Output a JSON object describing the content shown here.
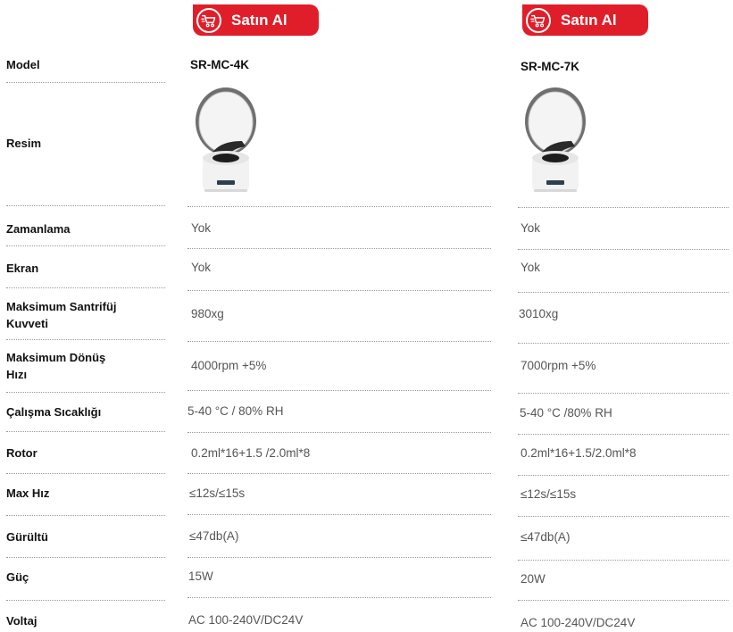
{
  "buttons": {
    "buy_label": "Satın Al"
  },
  "colors": {
    "accent": "#e01e2a",
    "label_text": "#111111",
    "value_text": "#555555",
    "divider": "#999999"
  },
  "icons": {
    "buy": "shopping-cart-icon",
    "product": "mini-centrifuge-image"
  },
  "products": [
    {
      "model": "SR-MC-4K"
    },
    {
      "model": "SR-MC-7K"
    }
  ],
  "rows": [
    {
      "label": "Model"
    },
    {
      "label": "Resim"
    },
    {
      "label": "Zamanlama",
      "values": [
        "Yok",
        "Yok"
      ]
    },
    {
      "label": "Ekran",
      "values": [
        "Yok",
        "Yok"
      ]
    },
    {
      "label_lines": [
        "Maksimum Santrifüj",
        "Kuvveti"
      ],
      "values": [
        "980xg",
        "3010xg"
      ]
    },
    {
      "label_lines": [
        "Maksimum Dönüş",
        "Hızı"
      ],
      "values": [
        "4000rpm +5%",
        "7000rpm +5%"
      ]
    },
    {
      "label": "Çalışma Sıcaklığı",
      "values": [
        "5-40 °C / 80% RH",
        "5-40 °C /80% RH"
      ]
    },
    {
      "label": "Rotor",
      "values": [
        "0.2ml*16+1.5 /2.0ml*8",
        "0.2ml*16+1.5/2.0ml*8"
      ]
    },
    {
      "label": "Max Hız",
      "values": [
        "≤12s/≤15s",
        "≤12s/≤15s"
      ]
    },
    {
      "label": "Gürültü",
      "values": [
        "≤47db(A)",
        "≤47db(A)"
      ]
    },
    {
      "label": "Güç",
      "values": [
        "15W",
        "20W"
      ]
    },
    {
      "label": "Voltaj",
      "values": [
        "AC 100-240V/DC24V",
        "AC 100-240V/DC24V"
      ]
    }
  ]
}
